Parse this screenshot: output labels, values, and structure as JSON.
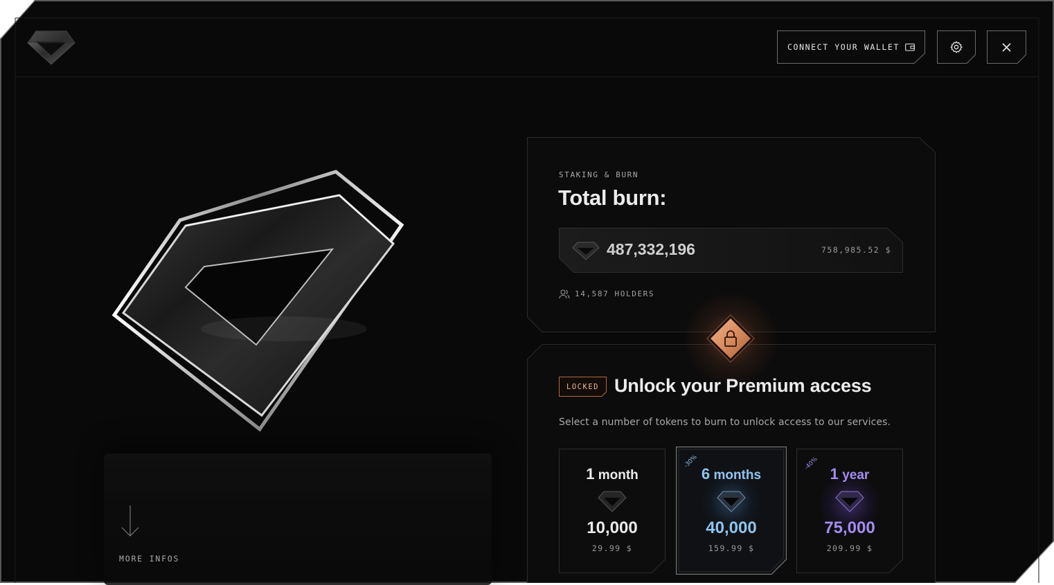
{
  "header": {
    "connect_wallet_label": "CONNECT YOUR WALLET",
    "icons": [
      "diamond-logo",
      "wallet-icon",
      "gear-icon",
      "close-icon"
    ]
  },
  "hero": {
    "more_infos_label": "MORE INFOS"
  },
  "burn_panel": {
    "eyebrow": "STAKING & BURN",
    "title": "Total burn:",
    "amount": "487,332,196",
    "usd_value": "758,985.52 $",
    "holders": "14,587 HOLDERS"
  },
  "premium_panel": {
    "badge": "LOCKED",
    "title": "Unlock your Premium access",
    "description": "Select a number of tokens to burn to unlock access to our services.",
    "plans": [
      {
        "num": "1",
        "unit": "month",
        "tokens": "10,000",
        "price": "29.99 $",
        "discount": "",
        "color": "#ececec",
        "selected": false
      },
      {
        "num": "6",
        "unit": "months",
        "tokens": "40,000",
        "price": "159.99 $",
        "discount": "-30%",
        "color": "#8fc4ee",
        "selected": true
      },
      {
        "num": "1",
        "unit": "year",
        "tokens": "75,000",
        "price": "209.99 $",
        "discount": "-40%",
        "color": "#a58cf0",
        "selected": false
      }
    ]
  },
  "colors": {
    "background": "#090909",
    "accent_lock": "#d98c5f",
    "plan_6_months": "#8fc4ee",
    "plan_1_year": "#a58cf0"
  }
}
